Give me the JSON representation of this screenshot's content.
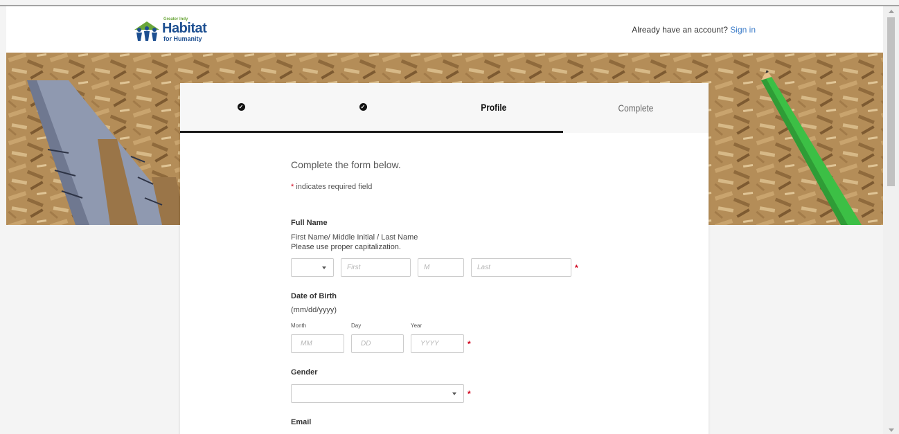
{
  "header": {
    "logo": {
      "tagline": "Greater Indy",
      "main": "Habitat",
      "sub": "for Humanity"
    },
    "account_prompt": "Already have an account?",
    "signin_label": "Sign in"
  },
  "steps": [
    {
      "label": "",
      "state": "done"
    },
    {
      "label": "",
      "state": "done"
    },
    {
      "label": "Profile",
      "state": "active"
    },
    {
      "label": "Complete",
      "state": "upcoming"
    }
  ],
  "form": {
    "intro": "Complete the form below.",
    "required_note_star": "*",
    "required_note_text": " indicates required field",
    "full_name": {
      "label": "Full Name",
      "help_line1": "First Name/ Middle Initial / Last Name",
      "help_line2": "Please use proper capitalization.",
      "first_placeholder": "First",
      "middle_placeholder": "M",
      "last_placeholder": "Last"
    },
    "dob": {
      "label": "Date of Birth",
      "help": "(mm/dd/yyyy)",
      "month_label": "Month",
      "day_label": "Day",
      "year_label": "Year",
      "month_placeholder": "MM",
      "day_placeholder": "DD",
      "year_placeholder": "YYYY"
    },
    "gender": {
      "label": "Gender"
    },
    "email": {
      "label": "Email"
    },
    "required_star": "*"
  },
  "colors": {
    "link": "#3a7bc8",
    "required": "#d0021b",
    "logo_blue": "#1d4f91",
    "logo_green": "#6aa63a"
  }
}
